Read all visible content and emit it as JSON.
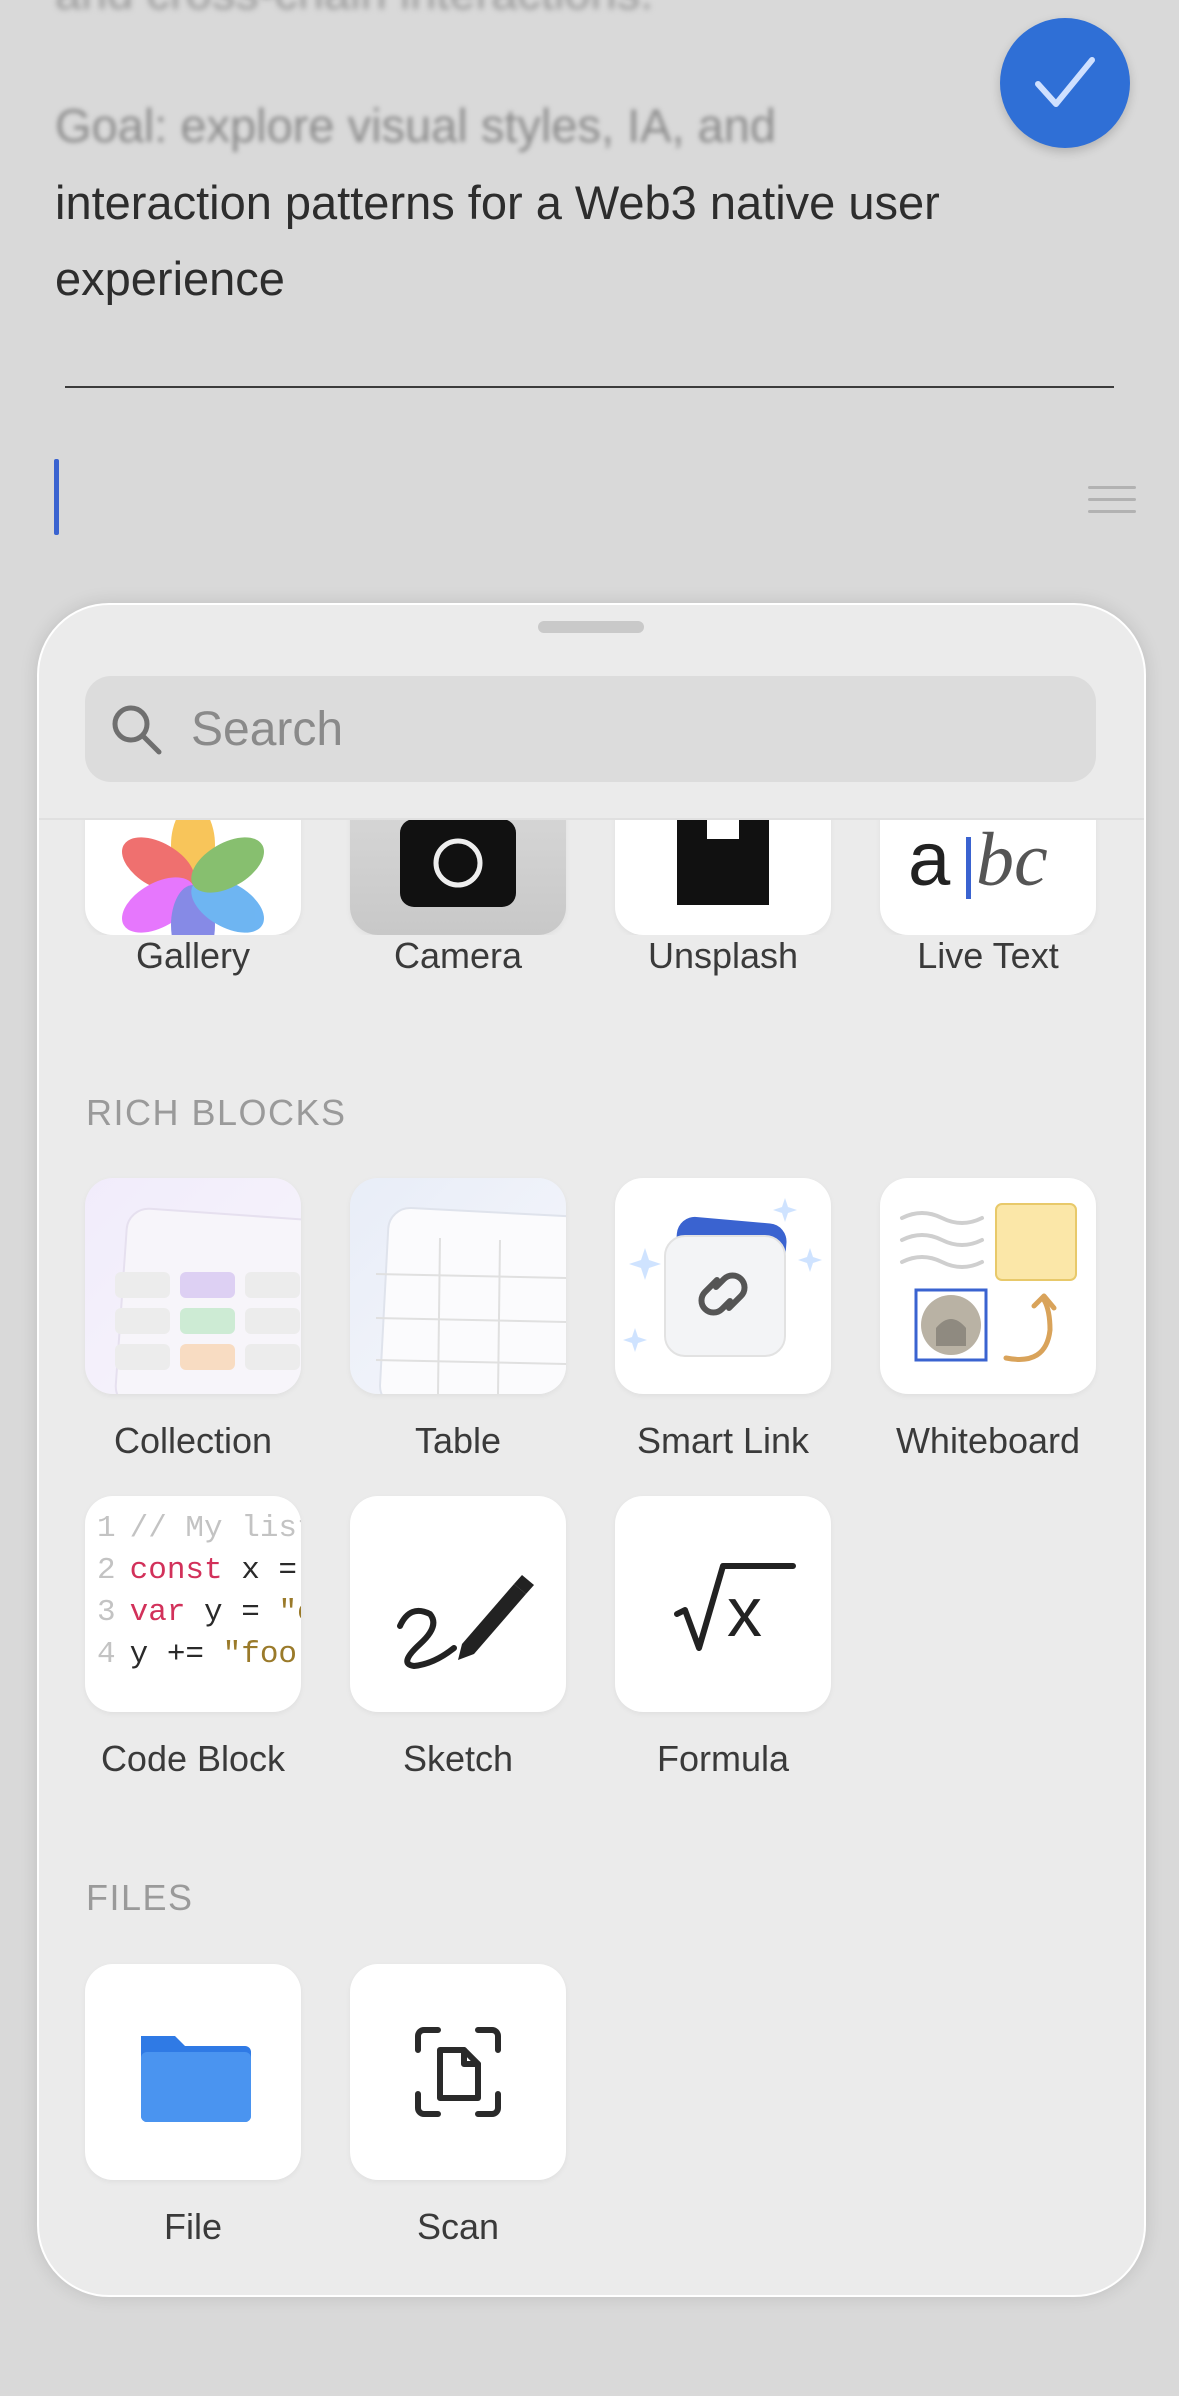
{
  "document": {
    "faded_line": "and cross-chain interactions.",
    "goal_line": "Goal: explore visual styles, IA, and",
    "line_2": "interaction patterns for a Web3 native user",
    "line_3": "experience"
  },
  "search": {
    "placeholder": "Search"
  },
  "media": {
    "items": [
      {
        "label": "Gallery",
        "icon": "photos-icon"
      },
      {
        "label": "Camera",
        "icon": "camera-icon"
      },
      {
        "label": "Unsplash",
        "icon": "unsplash-icon"
      },
      {
        "label": "Live Text",
        "icon": "live-text-icon"
      }
    ]
  },
  "rich_blocks": {
    "title": "RICH BLOCKS",
    "items": [
      {
        "label": "Collection",
        "icon": "collection-icon"
      },
      {
        "label": "Table",
        "icon": "table-icon"
      },
      {
        "label": "Smart Link",
        "icon": "link-icon"
      },
      {
        "label": "Whiteboard",
        "icon": "whiteboard-icon"
      },
      {
        "label": "Code Block",
        "icon": "code-icon"
      },
      {
        "label": "Sketch",
        "icon": "pen-icon"
      },
      {
        "label": "Formula",
        "icon": "sqrt-icon"
      }
    ],
    "code_preview": {
      "n1": "1",
      "l1": "// My list",
      "n2": "2",
      "l2k": "const",
      "l2": " x = cr",
      "n3": "3",
      "l3k": "var",
      "l3": " y = ",
      "l3s": "\"craf",
      "n4": "4",
      "l4": "y += ",
      "l4s": "\"foo\""
    },
    "live_text_preview": "abc"
  },
  "files": {
    "title": "FILES",
    "items": [
      {
        "label": "File",
        "icon": "folder-icon"
      },
      {
        "label": "Scan",
        "icon": "scan-icon"
      }
    ]
  },
  "colors": {
    "accent": "#2f6fd6",
    "sheet": "#ebebeb"
  }
}
